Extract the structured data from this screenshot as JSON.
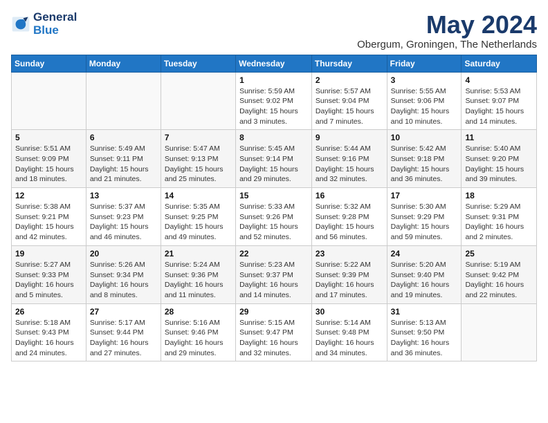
{
  "logo": {
    "line1": "General",
    "line2": "Blue"
  },
  "title": "May 2024",
  "location": "Obergum, Groningen, The Netherlands",
  "days_of_week": [
    "Sunday",
    "Monday",
    "Tuesday",
    "Wednesday",
    "Thursday",
    "Friday",
    "Saturday"
  ],
  "weeks": [
    [
      {
        "day": "",
        "info": ""
      },
      {
        "day": "",
        "info": ""
      },
      {
        "day": "",
        "info": ""
      },
      {
        "day": "1",
        "info": "Sunrise: 5:59 AM\nSunset: 9:02 PM\nDaylight: 15 hours\nand 3 minutes."
      },
      {
        "day": "2",
        "info": "Sunrise: 5:57 AM\nSunset: 9:04 PM\nDaylight: 15 hours\nand 7 minutes."
      },
      {
        "day": "3",
        "info": "Sunrise: 5:55 AM\nSunset: 9:06 PM\nDaylight: 15 hours\nand 10 minutes."
      },
      {
        "day": "4",
        "info": "Sunrise: 5:53 AM\nSunset: 9:07 PM\nDaylight: 15 hours\nand 14 minutes."
      }
    ],
    [
      {
        "day": "5",
        "info": "Sunrise: 5:51 AM\nSunset: 9:09 PM\nDaylight: 15 hours\nand 18 minutes."
      },
      {
        "day": "6",
        "info": "Sunrise: 5:49 AM\nSunset: 9:11 PM\nDaylight: 15 hours\nand 21 minutes."
      },
      {
        "day": "7",
        "info": "Sunrise: 5:47 AM\nSunset: 9:13 PM\nDaylight: 15 hours\nand 25 minutes."
      },
      {
        "day": "8",
        "info": "Sunrise: 5:45 AM\nSunset: 9:14 PM\nDaylight: 15 hours\nand 29 minutes."
      },
      {
        "day": "9",
        "info": "Sunrise: 5:44 AM\nSunset: 9:16 PM\nDaylight: 15 hours\nand 32 minutes."
      },
      {
        "day": "10",
        "info": "Sunrise: 5:42 AM\nSunset: 9:18 PM\nDaylight: 15 hours\nand 36 minutes."
      },
      {
        "day": "11",
        "info": "Sunrise: 5:40 AM\nSunset: 9:20 PM\nDaylight: 15 hours\nand 39 minutes."
      }
    ],
    [
      {
        "day": "12",
        "info": "Sunrise: 5:38 AM\nSunset: 9:21 PM\nDaylight: 15 hours\nand 42 minutes."
      },
      {
        "day": "13",
        "info": "Sunrise: 5:37 AM\nSunset: 9:23 PM\nDaylight: 15 hours\nand 46 minutes."
      },
      {
        "day": "14",
        "info": "Sunrise: 5:35 AM\nSunset: 9:25 PM\nDaylight: 15 hours\nand 49 minutes."
      },
      {
        "day": "15",
        "info": "Sunrise: 5:33 AM\nSunset: 9:26 PM\nDaylight: 15 hours\nand 52 minutes."
      },
      {
        "day": "16",
        "info": "Sunrise: 5:32 AM\nSunset: 9:28 PM\nDaylight: 15 hours\nand 56 minutes."
      },
      {
        "day": "17",
        "info": "Sunrise: 5:30 AM\nSunset: 9:29 PM\nDaylight: 15 hours\nand 59 minutes."
      },
      {
        "day": "18",
        "info": "Sunrise: 5:29 AM\nSunset: 9:31 PM\nDaylight: 16 hours\nand 2 minutes."
      }
    ],
    [
      {
        "day": "19",
        "info": "Sunrise: 5:27 AM\nSunset: 9:33 PM\nDaylight: 16 hours\nand 5 minutes."
      },
      {
        "day": "20",
        "info": "Sunrise: 5:26 AM\nSunset: 9:34 PM\nDaylight: 16 hours\nand 8 minutes."
      },
      {
        "day": "21",
        "info": "Sunrise: 5:24 AM\nSunset: 9:36 PM\nDaylight: 16 hours\nand 11 minutes."
      },
      {
        "day": "22",
        "info": "Sunrise: 5:23 AM\nSunset: 9:37 PM\nDaylight: 16 hours\nand 14 minutes."
      },
      {
        "day": "23",
        "info": "Sunrise: 5:22 AM\nSunset: 9:39 PM\nDaylight: 16 hours\nand 17 minutes."
      },
      {
        "day": "24",
        "info": "Sunrise: 5:20 AM\nSunset: 9:40 PM\nDaylight: 16 hours\nand 19 minutes."
      },
      {
        "day": "25",
        "info": "Sunrise: 5:19 AM\nSunset: 9:42 PM\nDaylight: 16 hours\nand 22 minutes."
      }
    ],
    [
      {
        "day": "26",
        "info": "Sunrise: 5:18 AM\nSunset: 9:43 PM\nDaylight: 16 hours\nand 24 minutes."
      },
      {
        "day": "27",
        "info": "Sunrise: 5:17 AM\nSunset: 9:44 PM\nDaylight: 16 hours\nand 27 minutes."
      },
      {
        "day": "28",
        "info": "Sunrise: 5:16 AM\nSunset: 9:46 PM\nDaylight: 16 hours\nand 29 minutes."
      },
      {
        "day": "29",
        "info": "Sunrise: 5:15 AM\nSunset: 9:47 PM\nDaylight: 16 hours\nand 32 minutes."
      },
      {
        "day": "30",
        "info": "Sunrise: 5:14 AM\nSunset: 9:48 PM\nDaylight: 16 hours\nand 34 minutes."
      },
      {
        "day": "31",
        "info": "Sunrise: 5:13 AM\nSunset: 9:50 PM\nDaylight: 16 hours\nand 36 minutes."
      },
      {
        "day": "",
        "info": ""
      }
    ]
  ]
}
